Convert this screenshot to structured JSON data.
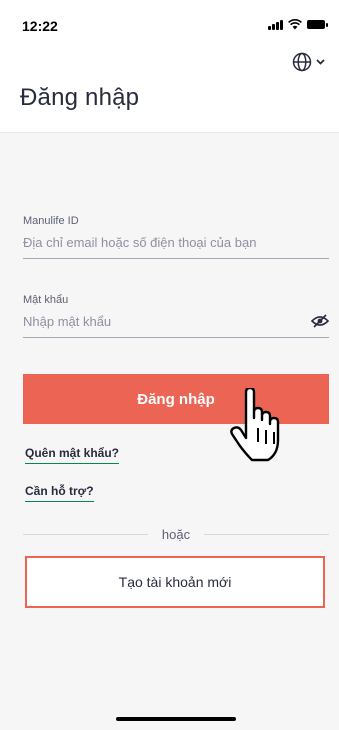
{
  "status_bar": {
    "time": "12:22"
  },
  "header": {
    "title": "Đăng nhập",
    "language_icon": "globe-icon",
    "language_menu_icon": "chevron-down-icon"
  },
  "form": {
    "id_field": {
      "label": "Manulife ID",
      "placeholder": "Địa chỉ email hoặc số điện thoại của bạn"
    },
    "password_field": {
      "label": "Mật khẩu",
      "placeholder": "Nhập mật khẩu",
      "toggle_icon": "eye-off-icon"
    },
    "login_button": "Đăng nhập",
    "forgot_password_link": "Quên mật khẩu?",
    "help_link": "Cần hỗ trợ?",
    "divider_text": "hoặc",
    "create_account_button": "Tạo tài khoản mới"
  },
  "colors": {
    "accent": "#ec6453",
    "link_underline": "#06874e",
    "title": "#282b3e"
  }
}
